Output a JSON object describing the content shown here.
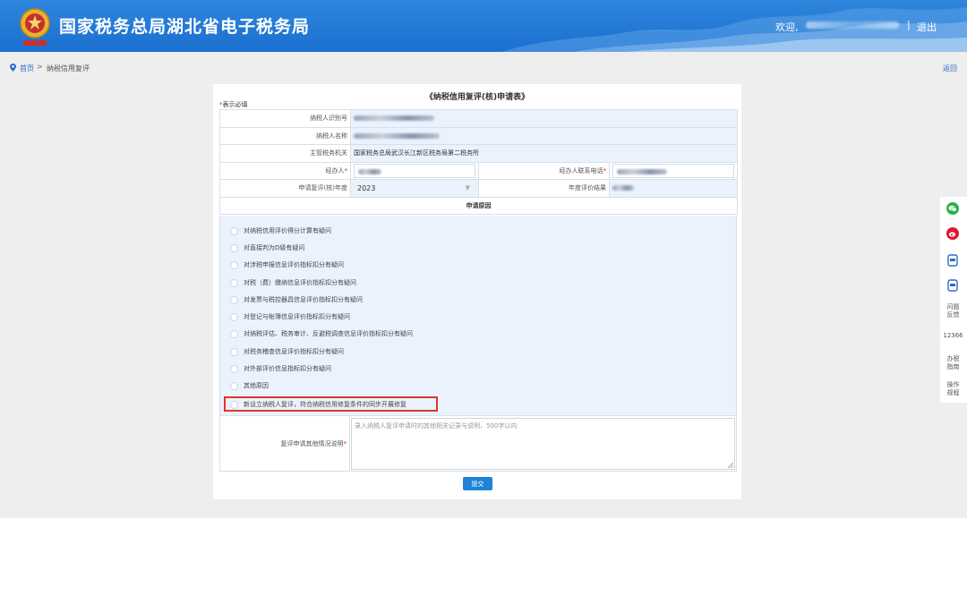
{
  "header": {
    "title": "国家税务总局湖北省电子税务局",
    "welcome": "欢迎,",
    "separator": "|",
    "logout": "退出",
    "bg_color": "#1b6fd0"
  },
  "breadcrumb": {
    "home": "首页",
    "separator": ">",
    "current": "纳税信用复评",
    "back": "返回"
  },
  "form": {
    "title": "《纳税信用复评(核)申请表》",
    "required_star": "*",
    "required_note": "表示必填",
    "fields": {
      "taxpayer_id_label": "纳税人识别号",
      "taxpayer_name_label": "纳税人名称",
      "tax_authority_label": "主管税务机关",
      "tax_authority_value": "国家税务总局武汉长江新区税务局第二税务所",
      "agent_label": "经办人",
      "agent_phone_label": "经办人联系电话",
      "year_label": "申请复评(核)年度",
      "year_value": "2023",
      "result_label": "年度评价结果"
    },
    "section_reason": "申请原因",
    "reasons": [
      "对纳税信用评价得分计算有疑问",
      "对直接判为D级有疑问",
      "对涉税申报信息评价指标扣分有疑问",
      "对税（费）缴纳信息评价指标扣分有疑问",
      "对发票与税控器具信息评价指标扣分有疑问",
      "对登记与帐簿信息评价指标扣分有疑问",
      "对纳税评估、税务审计、反避税调查信息评价指标扣分有疑问",
      "对税务稽查信息评价指标扣分有疑问",
      "对外部评价信息指标扣分有疑问",
      "其他原因",
      "新设立纳税人复评，符合纳税信用修复条件的同步开展修复"
    ],
    "highlight_color": "#e0342a",
    "desc_label": "复评申请其他情况说明",
    "desc_placeholder": "录入纳税人复评申请时的其他相关记录与说明，500字以内",
    "submit": "提交"
  },
  "sidebar": {
    "icons": [
      "wechat-icon",
      "weibo-icon",
      "app-icon",
      "app-icon"
    ],
    "feedback": "问题\n反馈",
    "hotline": "12366",
    "guide": "办税\n指南",
    "procedure": "操作\n规程"
  }
}
